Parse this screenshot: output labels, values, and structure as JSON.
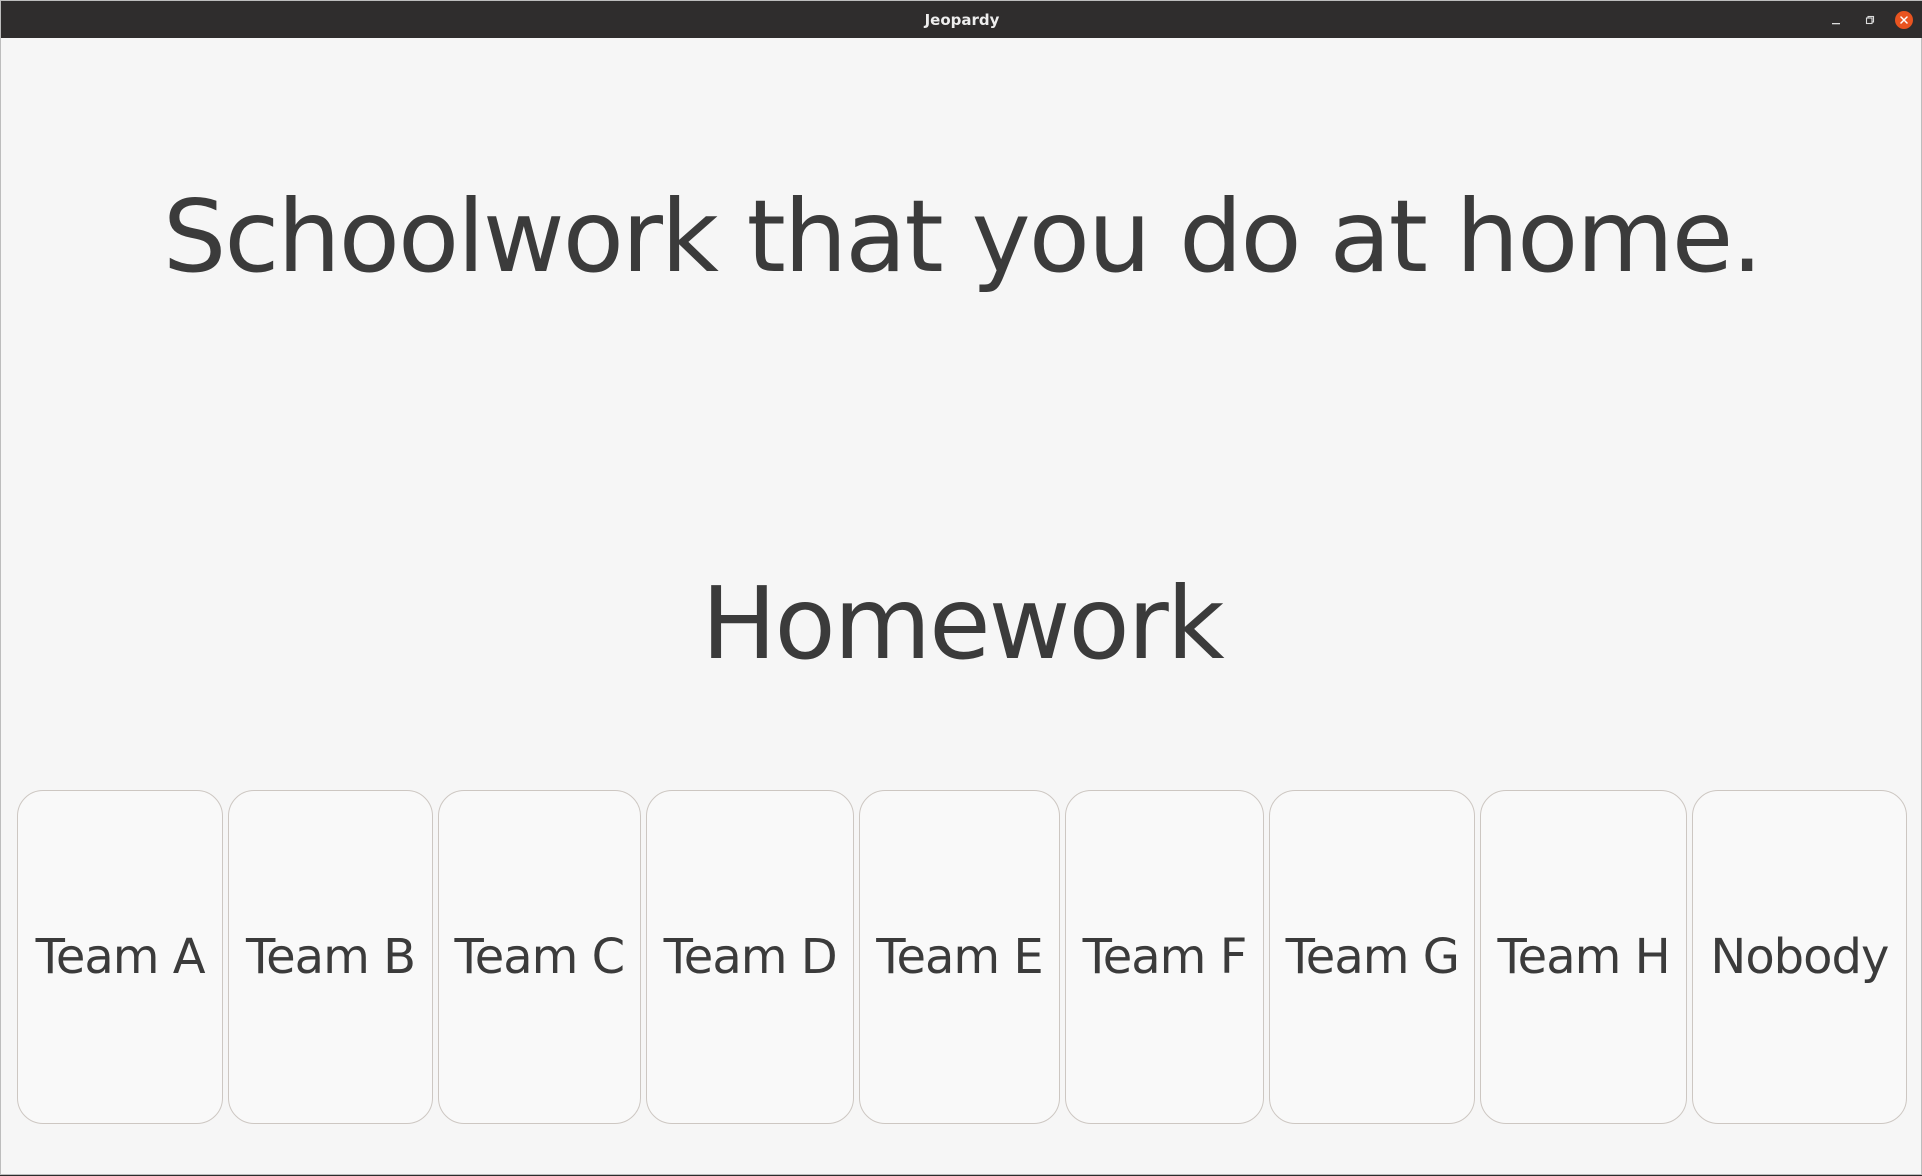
{
  "window": {
    "title": "Jeopardy",
    "controls": [
      "minimize-icon",
      "maximize-icon",
      "close-icon"
    ],
    "accent_close": "#e95420"
  },
  "clue": {
    "text": "Schoolwork that you do at home."
  },
  "answer": {
    "text": "Homework"
  },
  "teams": [
    {
      "label": "Team A"
    },
    {
      "label": "Team B"
    },
    {
      "label": "Team C"
    },
    {
      "label": "Team D"
    },
    {
      "label": "Team E"
    },
    {
      "label": "Team F"
    },
    {
      "label": "Team G"
    },
    {
      "label": "Team H"
    },
    {
      "label": "Nobody"
    }
  ]
}
